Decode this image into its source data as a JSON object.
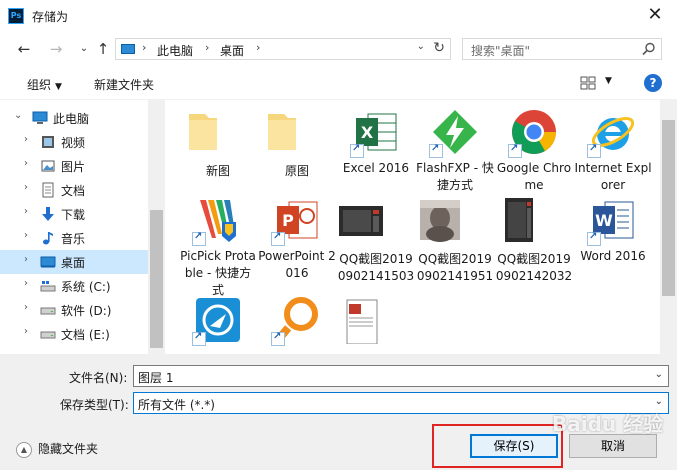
{
  "window": {
    "title": "存储为",
    "app_icon": "photoshop-icon"
  },
  "address": {
    "crumbs": [
      "此电脑",
      "桌面"
    ],
    "search_placeholder": "搜索\"桌面\""
  },
  "toolbar": {
    "organize_label": "组织",
    "new_folder_label": "新建文件夹"
  },
  "sidebar": {
    "items": [
      {
        "label": "此电脑",
        "icon": "computer-icon"
      },
      {
        "label": "视频",
        "icon": "video-icon"
      },
      {
        "label": "图片",
        "icon": "pictures-icon"
      },
      {
        "label": "文档",
        "icon": "documents-icon"
      },
      {
        "label": "下载",
        "icon": "download-icon"
      },
      {
        "label": "音乐",
        "icon": "music-icon"
      },
      {
        "label": "桌面",
        "icon": "desktop-icon",
        "selected": true
      },
      {
        "label": "系统 (C:)",
        "icon": "drive-icon"
      },
      {
        "label": "软件 (D:)",
        "icon": "drive-icon"
      },
      {
        "label": "文档 (E:)",
        "icon": "drive-icon"
      }
    ]
  },
  "files": [
    {
      "label": "新图",
      "icon": "folder-icon"
    },
    {
      "label": "原图",
      "icon": "folder-icon"
    },
    {
      "label": "Excel 2016",
      "icon": "excel-icon"
    },
    {
      "label": "FlashFXP - 快捷方式",
      "icon": "flashfxp-icon"
    },
    {
      "label": "Google Chrome",
      "icon": "chrome-icon"
    },
    {
      "label": "Internet Explorer",
      "icon": "ie-icon"
    },
    {
      "label": "PicPick Protable - 快捷方式",
      "icon": "picpick-icon"
    },
    {
      "label": "PowerPoint 2016",
      "icon": "powerpoint-icon"
    },
    {
      "label": "QQ截图20190902141503",
      "icon": "screenshot-thumb-icon"
    },
    {
      "label": "QQ截图20190902141951",
      "icon": "photo-thumb-icon"
    },
    {
      "label": "QQ截图20190902142032",
      "icon": "screenshot-thumb-icon"
    },
    {
      "label": "Word 2016",
      "icon": "word-icon"
    },
    {
      "label": "",
      "icon": "app-icon"
    },
    {
      "label": "",
      "icon": "search-app-icon"
    },
    {
      "label": "",
      "icon": "document-thumb-icon"
    }
  ],
  "form": {
    "filename_label": "文件名(N):",
    "filename_value": "图层 1",
    "filetype_label": "保存类型(T):",
    "filetype_value": "所有文件 (*.*)"
  },
  "buttons": {
    "save": "保存(S)",
    "cancel": "取消"
  },
  "hide_folders_label": "隐藏文件夹",
  "watermark": "Baidu 经验"
}
